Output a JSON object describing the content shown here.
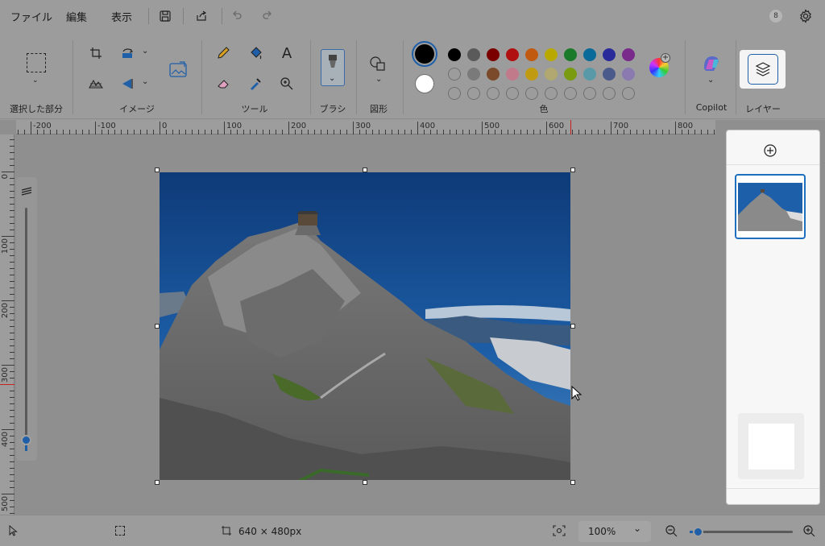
{
  "menu": {
    "file": "ファイル",
    "edit": "編集",
    "view": "表示"
  },
  "account_initial": "8",
  "ribbon": {
    "selection_label": "選択した部分",
    "image_label": "イメージ",
    "tools_label": "ツール",
    "brush_label": "ブラシ",
    "shapes_label": "図形",
    "colors_label": "色",
    "copilot_label": "Copilot",
    "layers_label": "レイヤー",
    "text_tool_glyph": "A"
  },
  "colors": {
    "primary": "#000000",
    "secondary": "#ffffff",
    "palette_row1": [
      "#000000",
      "#5a5a5a",
      "#7a0000",
      "#b01010",
      "#c05a10",
      "#b8a800",
      "#1a7a2a",
      "#0a6a9a",
      "#2a2a9a",
      "#7a2a8a"
    ],
    "palette_row2": [
      "#ffffff",
      "#7a7a7a",
      "#7a4a2a",
      "#c07a8a",
      "#c09a10",
      "#b0a870",
      "#7a9a10",
      "#5a9aa8",
      "#4a5a8a",
      "#8a7ab0"
    ],
    "accent": "#1f6fbf"
  },
  "ruler": {
    "h_labels": [
      "-200",
      "-100",
      "0",
      "100",
      "200",
      "300",
      "400",
      "500",
      "600",
      "700",
      "800"
    ],
    "v_labels": [
      "0",
      "100",
      "200",
      "300",
      "400",
      "500"
    ]
  },
  "layers_panel": {
    "add_icon": "add-layer-icon"
  },
  "status": {
    "canvas_size": "640 × 480px",
    "zoom": "100%",
    "zoom_slider_fraction": 0.08
  }
}
